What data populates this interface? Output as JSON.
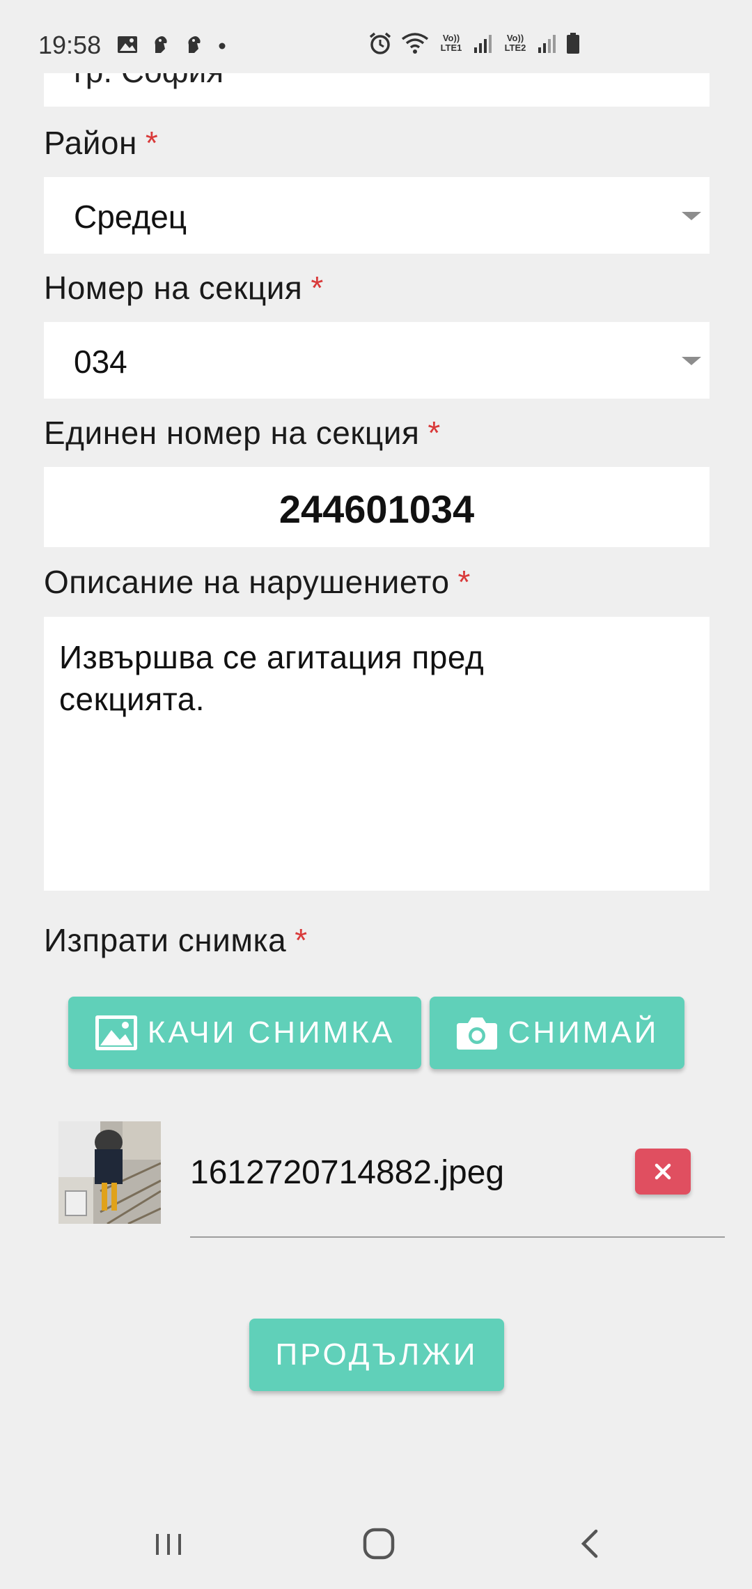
{
  "status_bar": {
    "time": "19:58",
    "left_icons": [
      "image-notification-icon",
      "premier-league-icon",
      "premier-league-icon",
      "dot-icon"
    ],
    "right_icons": [
      "alarm-icon",
      "wifi-icon",
      "volte-lte1-icon",
      "signal-icon",
      "volte-lte2-icon",
      "signal-icon",
      "battery-icon"
    ],
    "lte1_label": "Vo)) LTE1",
    "lte2_label": "Vo)) LTE2"
  },
  "form": {
    "city_select_partial": "гр. София",
    "district": {
      "label": "Район",
      "required_mark": "*",
      "value": "Средец"
    },
    "section_number": {
      "label": "Номер на секция",
      "required_mark": "*",
      "value": "034"
    },
    "unique_section_number": {
      "label": "Единен номер на секция",
      "required_mark": "*",
      "value": "244601034"
    },
    "violation_description": {
      "label": "Описание на нарушението",
      "required_mark": "*",
      "value": "Извършва се агитация пред секцията."
    },
    "send_photo": {
      "label": "Изпрати снимка",
      "required_mark": "*",
      "upload_button": "КАЧИ СНИМКА",
      "camera_button": "СНИМАЙ"
    },
    "attachment": {
      "file_name": "1612720714882.jpeg",
      "remove_symbol": "×"
    },
    "continue_button": "ПРОДЪЛЖИ"
  },
  "colors": {
    "background": "#efefef",
    "accent_teal": "#60d0b9",
    "required_red": "#d93a3a",
    "remove_red": "#e04f60"
  },
  "nav_bar": {
    "items": [
      "recent-apps-icon",
      "home-icon",
      "back-icon"
    ]
  }
}
